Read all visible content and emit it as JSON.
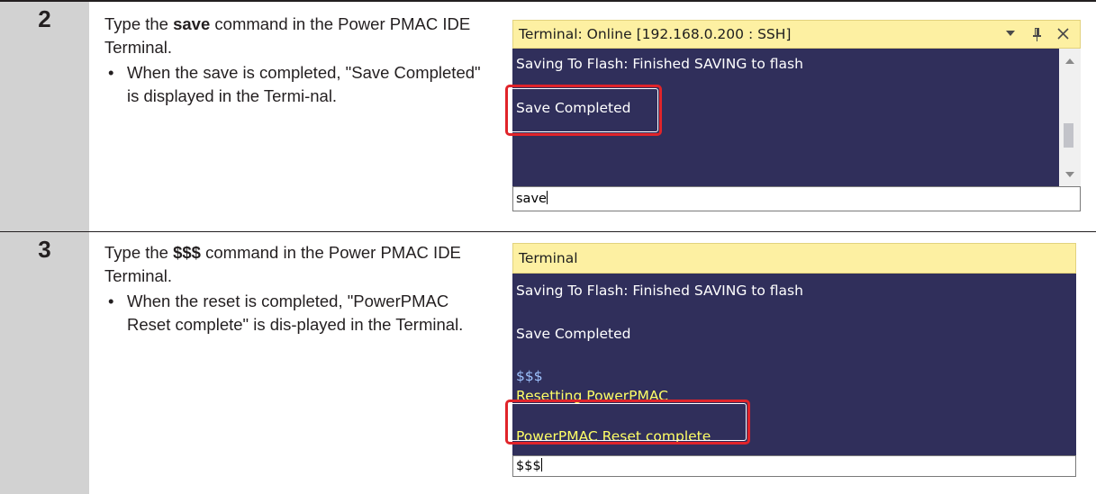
{
  "steps": [
    {
      "number": "2",
      "text_before": "Type the ",
      "command": "save",
      "text_after": " command in the Power PMAC IDE Terminal.",
      "bullet": "When the save is completed, \"Save Completed\" is displayed in the Termi-nal.",
      "terminal": {
        "title": "Terminal: Online [192.168.0.200 : SSH]",
        "output_lines": [
          "Saving To Flash: Finished SAVING to flash",
          "Save Completed"
        ],
        "highlighted_line": "Save Completed",
        "input_value": "save",
        "icons": [
          "dropdown-arrow-icon",
          "pin-icon",
          "close-icon"
        ]
      }
    },
    {
      "number": "3",
      "text_before": "Type the ",
      "command": "$$$",
      "text_after": " command in the Power PMAC IDE Terminal.",
      "bullet": "When the reset is completed, \"PowerPMAC Reset complete\" is dis-played in the Terminal.",
      "terminal": {
        "title": "Terminal",
        "output_lines": [
          "Saving To Flash: Finished SAVING to flash",
          "Save Completed",
          "$$$",
          "Resetting PowerPMAC",
          "PowerPMAC Reset complete"
        ],
        "highlighted_line": "PowerPMAC Reset complete",
        "input_value": "$$$"
      }
    }
  ],
  "colors": {
    "terminal_bg": "#302f5b",
    "title_bg": "#fdf0a2",
    "highlight": "#e0242a",
    "command_echo": "#9fc4ff",
    "reset_text": "#ffff66"
  },
  "icons": {
    "bullet": "•"
  }
}
